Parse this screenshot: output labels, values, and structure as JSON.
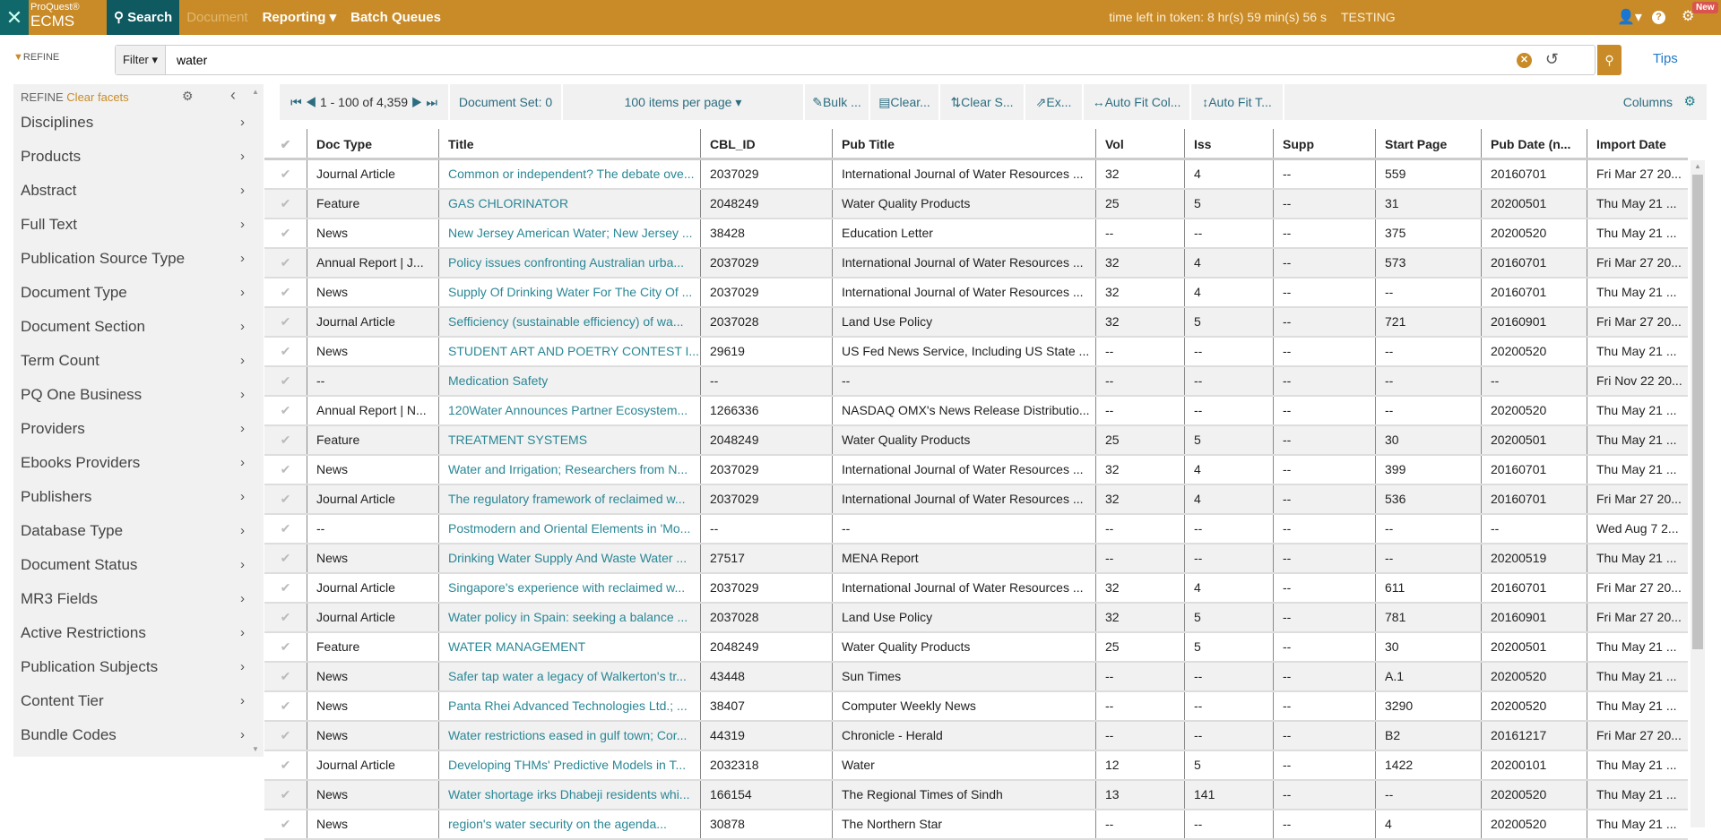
{
  "header": {
    "brand_top": "ProQuest®",
    "brand_bottom": "ECMS",
    "nav": [
      "Search",
      "Document",
      "Reporting ▾",
      "Batch Queues"
    ],
    "token": "time left in token: 8 hr(s) 59 min(s) 56 s",
    "env": "TESTING",
    "new_badge": "New",
    "colors": {
      "bar": "#c98b27",
      "active": "#0e5a60"
    }
  },
  "search": {
    "refine": "REFINE",
    "filter": "Filter ▾",
    "value": "water",
    "tips": "Tips"
  },
  "sidebar": {
    "title": "REFINE",
    "clear": "Clear facets",
    "items": [
      "Disciplines",
      "Products",
      "Abstract",
      "Full Text",
      "Publication Source Type",
      "Document Type",
      "Document Section",
      "Term Count",
      "PQ One Business",
      "Providers",
      "Ebooks Providers",
      "Publishers",
      "Database Type",
      "Document Status",
      "MR3 Fields",
      "Active Restrictions",
      "Publication Subjects",
      "Content Tier",
      "Bundle Codes"
    ]
  },
  "toolbar": {
    "pager": "1 - 100 of 4,359",
    "docset": "Document Set: 0",
    "per_page": "100 items per page ▾",
    "bulk": "✎Bulk ...",
    "clear": "▤Clear...",
    "clear_s": "⇅Clear S...",
    "export": "⇗Ex...",
    "autofit_col": "↔Auto Fit Col...",
    "autofit_t": "↕Auto Fit T...",
    "columns": "Columns"
  },
  "table": {
    "columns": [
      "Doc Type",
      "Title",
      "CBL_ID",
      "Pub Title",
      "Vol",
      "Iss",
      "Supp",
      "Start Page",
      "Pub Date (n...",
      "Import Date"
    ],
    "rows": [
      [
        "Journal Article",
        "Common or independent? The debate ove...",
        "2037029",
        "International Journal of Water Resources ...",
        "32",
        "4",
        "--",
        "559",
        "20160701",
        "Fri Mar 27 20..."
      ],
      [
        "Feature",
        "GAS CHLORINATOR",
        "2048249",
        "Water Quality Products",
        "25",
        "5",
        "--",
        "31",
        "20200501",
        "Thu May 21 ..."
      ],
      [
        "News",
        "New Jersey American Water; New Jersey ...",
        "38428",
        "Education Letter",
        "--",
        "--",
        "--",
        "375",
        "20200520",
        "Thu May 21 ..."
      ],
      [
        "Annual Report | J...",
        "Policy issues confronting Australian urba...",
        "2037029",
        "International Journal of Water Resources ...",
        "32",
        "4",
        "--",
        "573",
        "20160701",
        "Fri Mar 27 20..."
      ],
      [
        "News",
        "Supply Of Drinking Water For The City Of ...",
        "2037029",
        "International Journal of Water Resources ...",
        "32",
        "4",
        "--",
        "--",
        "20160701",
        "Thu May 21 ..."
      ],
      [
        "Journal Article",
        "Sefficiency (sustainable efficiency) of wa...",
        "2037028",
        "Land Use Policy",
        "32",
        "5",
        "--",
        "721",
        "20160901",
        "Fri Mar 27 20..."
      ],
      [
        "News",
        "STUDENT ART AND POETRY CONTEST I...",
        "29619",
        "US Fed News Service, Including US State ...",
        "--",
        "--",
        "--",
        "--",
        "20200520",
        "Thu May 21 ..."
      ],
      [
        "--",
        "Medication Safety",
        "--",
        "--",
        "--",
        "--",
        "--",
        "--",
        "--",
        "Fri Nov 22 20..."
      ],
      [
        "Annual Report | N...",
        "120Water Announces Partner Ecosystem...",
        "1266336",
        "NASDAQ OMX's News Release Distributio...",
        "--",
        "--",
        "--",
        "--",
        "20200520",
        "Thu May 21 ..."
      ],
      [
        "Feature",
        "TREATMENT SYSTEMS",
        "2048249",
        "Water Quality Products",
        "25",
        "5",
        "--",
        "30",
        "20200501",
        "Thu May 21 ..."
      ],
      [
        "News",
        "Water and Irrigation; Researchers from N...",
        "2037029",
        "International Journal of Water Resources ...",
        "32",
        "4",
        "--",
        "399",
        "20160701",
        "Thu May 21 ..."
      ],
      [
        "Journal Article",
        "The regulatory framework of reclaimed w...",
        "2037029",
        "International Journal of Water Resources ...",
        "32",
        "4",
        "--",
        "536",
        "20160701",
        "Fri Mar 27 20..."
      ],
      [
        "--",
        "Postmodern and Oriental Elements in 'Mo...",
        "--",
        "--",
        "--",
        "--",
        "--",
        "--",
        "--",
        "Wed Aug 7 2..."
      ],
      [
        "News",
        "Drinking Water Supply And Waste Water ...",
        "27517",
        "MENA Report",
        "--",
        "--",
        "--",
        "--",
        "20200519",
        "Thu May 21 ..."
      ],
      [
        "Journal Article",
        "Singapore's experience with reclaimed w...",
        "2037029",
        "International Journal of Water Resources ...",
        "32",
        "4",
        "--",
        "611",
        "20160701",
        "Fri Mar 27 20..."
      ],
      [
        "Journal Article",
        "Water policy in Spain: seeking a balance ...",
        "2037028",
        "Land Use Policy",
        "32",
        "5",
        "--",
        "781",
        "20160901",
        "Fri Mar 27 20..."
      ],
      [
        "Feature",
        "WATER MANAGEMENT",
        "2048249",
        "Water Quality Products",
        "25",
        "5",
        "--",
        "30",
        "20200501",
        "Thu May 21 ..."
      ],
      [
        "News",
        "Safer tap water a legacy of Walkerton's tr...",
        "43448",
        "Sun Times",
        "--",
        "--",
        "--",
        "A.1",
        "20200520",
        "Thu May 21 ..."
      ],
      [
        "News",
        "Panta Rhei Advanced Technologies Ltd.; ...",
        "38407",
        "Computer Weekly News",
        "--",
        "--",
        "--",
        "3290",
        "20200520",
        "Thu May 21 ..."
      ],
      [
        "News",
        "Water restrictions eased in gulf town; Cor...",
        "44319",
        "Chronicle - Herald",
        "--",
        "--",
        "--",
        "B2",
        "20161217",
        "Fri Mar 27 20..."
      ],
      [
        "Journal Article",
        "Developing THMs' Predictive Models in T...",
        "2032318",
        "Water",
        "12",
        "5",
        "--",
        "1422",
        "20200101",
        "Thu May 21 ..."
      ],
      [
        "News",
        "Water shortage irks Dhabeji residents whi...",
        "166154",
        "The Regional Times of Sindh",
        "13",
        "141",
        "--",
        "--",
        "20200520",
        "Thu May 21 ..."
      ],
      [
        "News",
        "region's water security on the agenda...",
        "30878",
        "The Northern Star",
        "--",
        "--",
        "--",
        "4",
        "20200520",
        "Thu May 21 ..."
      ]
    ]
  }
}
